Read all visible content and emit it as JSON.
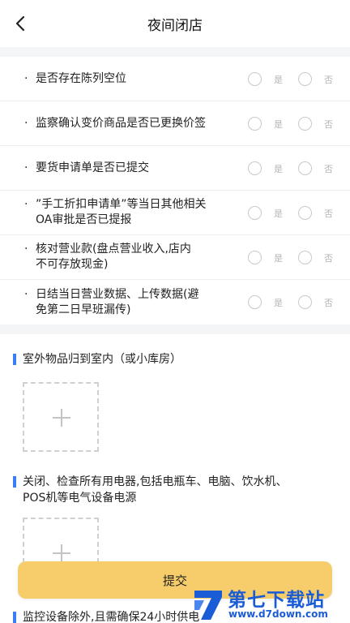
{
  "header": {
    "title": "夜间闭店"
  },
  "checklist": {
    "yes_label": "是",
    "no_label": "否",
    "bullet": "·",
    "items": [
      {
        "line1": "是否存在陈列空位",
        "line2": ""
      },
      {
        "line1": "监察确认变价商品是否已更换价签",
        "line2": ""
      },
      {
        "line1": "要货申请单是否已提交",
        "line2": ""
      },
      {
        "line1": "”手工折扣申请单”等当日其他相关",
        "line2": "OA审批是否已提报"
      },
      {
        "line1": "核对营业款(盘点营业收入,店内",
        "line2": "不可存放现金)"
      },
      {
        "line1": "日结当日营业数据、上传数据(避",
        "line2": "免第二日早班漏传)"
      }
    ]
  },
  "sections": [
    {
      "title_line1": "室外物品归到室内（或小库房）",
      "title_line2": ""
    },
    {
      "title_line1": "关闭、检查所有用电器,包括电瓶车、电脑、饮水机、",
      "title_line2": "POS机等电气设备电源"
    },
    {
      "title_line1": "监控设备除外,且需确保24小时供电",
      "title_line2": ""
    }
  ],
  "submit": {
    "label": "提交"
  },
  "watermark": {
    "name": "第七下载站",
    "url": "www.d7down.com"
  },
  "colors": {
    "accent": "#3b7df5",
    "submit_bg": "#f6cd6a",
    "watermark": "#1a5bd6"
  }
}
